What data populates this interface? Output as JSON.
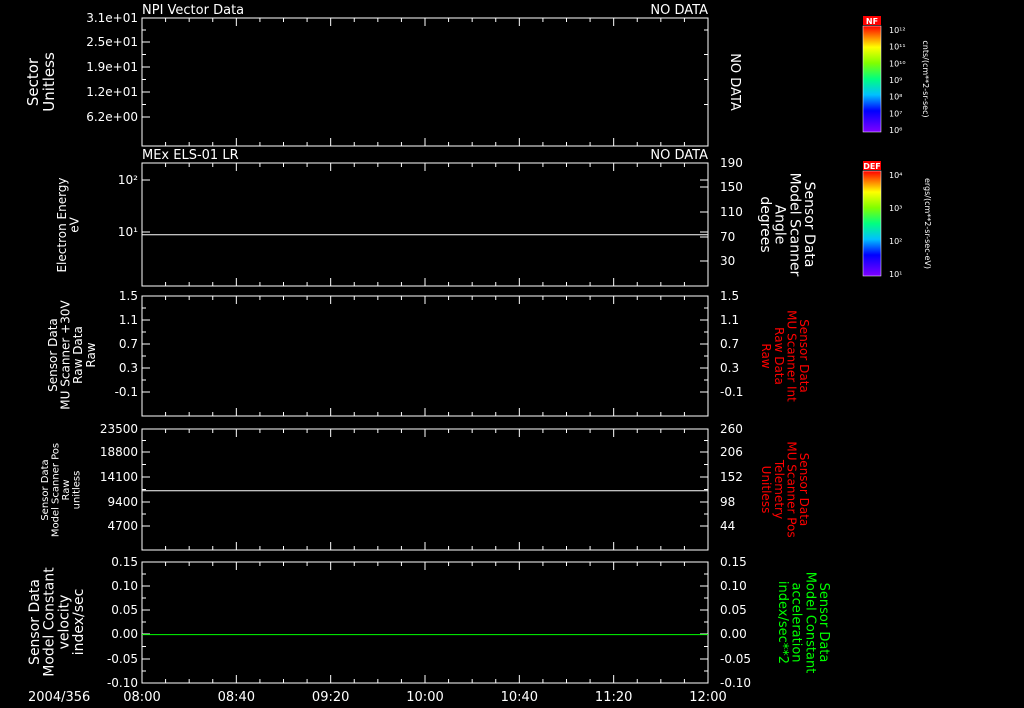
{
  "date_label": "2004/356",
  "x_ticks": [
    "08:00",
    "08:40",
    "09:20",
    "10:00",
    "10:40",
    "11:20",
    "12:00"
  ],
  "colorbars": [
    {
      "tag": "NF",
      "units": "cnts/(cm**2-sr-sec)",
      "ticks": [
        "10¹²",
        "10¹¹",
        "10¹⁰",
        "10⁹",
        "10⁸",
        "10⁷",
        "10⁶"
      ]
    },
    {
      "tag": "DEF",
      "units": "ergs/(cm**2-sr-sec-eV)",
      "ticks": [
        "10⁴",
        "10³",
        "10²",
        "10¹"
      ]
    }
  ],
  "chart_data": [
    {
      "type": "spectrogram",
      "title_left": "NPI Vector Data",
      "title_right": "NO DATA",
      "center_label": "NO DATA",
      "ylabel": [
        "Sector",
        "Unitless"
      ],
      "y_ticks": [
        "3.1e+01",
        "2.5e+01",
        "1.9e+01",
        "1.2e+01",
        "6.2e+00"
      ],
      "ylim": [
        0,
        31
      ],
      "series": []
    },
    {
      "type": "line",
      "title_left": "MEx ELS-01 LR",
      "title_right": "NO DATA",
      "ylabel": [
        "Electron Energy",
        "eV"
      ],
      "y_ticks": [
        "10²",
        "10¹"
      ],
      "y_scale": "log",
      "ylim": [
        1,
        200
      ],
      "ylabel_right": [
        "Sensor Data",
        "Model Scanner",
        "Angle",
        "degrees"
      ],
      "ylabel_right_color": "#ffffff",
      "y_ticks_right": [
        "190",
        "150",
        "110",
        "70",
        "30"
      ],
      "ylim_right": [
        10,
        190
      ],
      "series": [
        {
          "color": "#ffffff",
          "axis": "right",
          "x": [
            "08:00",
            "12:00"
          ],
          "y": [
            85,
            85
          ]
        }
      ]
    },
    {
      "type": "line",
      "ylabel": [
        "Sensor Data",
        "MU Scanner +30V",
        "Raw Data",
        "Raw"
      ],
      "y_ticks": [
        "1.5",
        "1.1",
        "0.7",
        "0.3",
        "-0.1"
      ],
      "ylim": [
        -0.3,
        1.5
      ],
      "ylabel_right": [
        "Sensor Data",
        "MU Scanner Int",
        "Raw Data",
        "Raw"
      ],
      "ylabel_right_color": "#ff0000",
      "y_ticks_right": [
        "1.5",
        "1.1",
        "0.7",
        "0.3",
        "-0.1"
      ],
      "ylim_right": [
        -0.3,
        1.5
      ],
      "series": []
    },
    {
      "type": "line",
      "ylabel": [
        "Sensor Data",
        "Model Scanner Pos",
        "Raw",
        "unitless"
      ],
      "y_ticks": [
        "23500",
        "18800",
        "14100",
        "9400",
        "4700"
      ],
      "ylim": [
        0,
        23500
      ],
      "ylabel_right": [
        "Sensor Data",
        "MU Scanner Pos",
        "Telemetry",
        "Unitless"
      ],
      "ylabel_right_color": "#ff0000",
      "y_ticks_right": [
        "260",
        "206",
        "152",
        "98",
        "44"
      ],
      "ylim_right": [
        -10,
        260
      ],
      "series": [
        {
          "color": "#ffffff",
          "axis": "left",
          "x": [
            "08:00",
            "12:00"
          ],
          "y": [
            11500,
            11500
          ]
        }
      ]
    },
    {
      "type": "line",
      "ylabel": [
        "Sensor Data",
        "Model Constant",
        "velocity",
        "index/sec"
      ],
      "y_ticks": [
        "0.15",
        "0.10",
        "0.05",
        "0.00",
        "-0.05",
        "-0.10"
      ],
      "ylim": [
        -0.1,
        0.15
      ],
      "ylabel_right": [
        "Sensor Data",
        "Model Constant",
        "acceleration",
        "index/sec**2"
      ],
      "ylabel_right_color": "#00ff00",
      "y_ticks_right": [
        "0.15",
        "0.10",
        "0.05",
        "0.00",
        "-0.05",
        "-0.10"
      ],
      "ylim_right": [
        -0.1,
        0.15
      ],
      "series": [
        {
          "color": "#00ff00",
          "axis": "left",
          "x": [
            "08:00",
            "12:00"
          ],
          "y": [
            0.0,
            0.0
          ]
        }
      ]
    }
  ]
}
